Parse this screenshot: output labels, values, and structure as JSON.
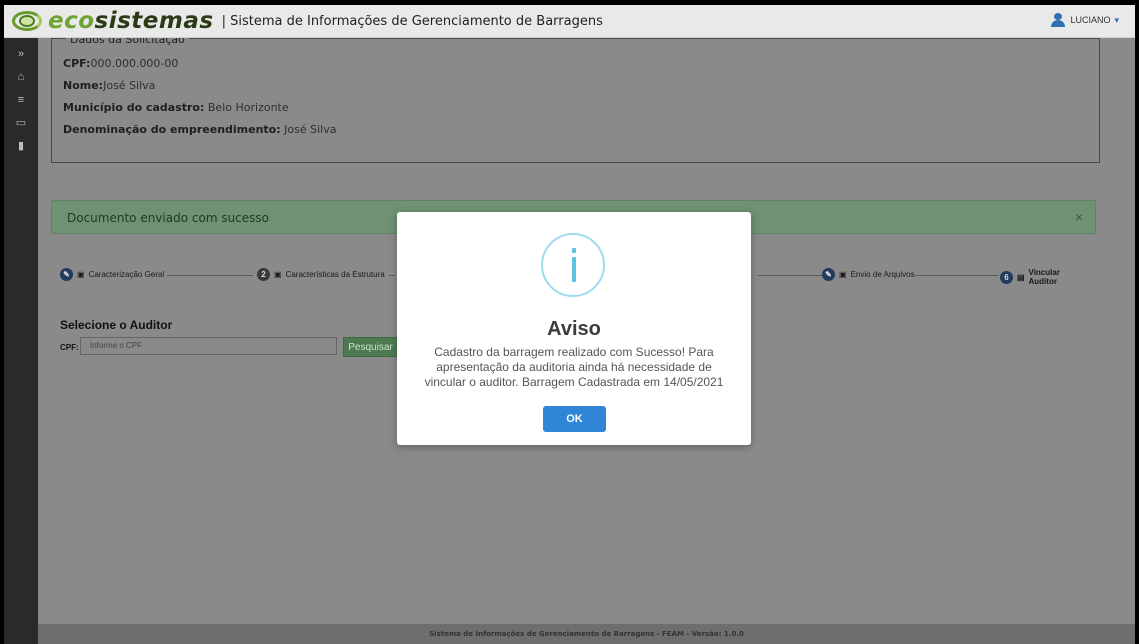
{
  "header": {
    "brand_eco": "eco",
    "brand_sistemas": "sistemas",
    "app_title": "| Sistema de Informações de Gerenciamento de Barragens",
    "user_name": "LUCIANO",
    "user_caret": "▾"
  },
  "sidebar": {
    "items": [
      {
        "icon": "double-chevron-icon",
        "glyph": "»"
      },
      {
        "icon": "home-icon",
        "glyph": "⌂"
      },
      {
        "icon": "menu-icon",
        "glyph": "≡"
      },
      {
        "icon": "id-card-icon",
        "glyph": "▭"
      },
      {
        "icon": "documents-icon",
        "glyph": "▮"
      }
    ]
  },
  "dados": {
    "legend": "Dados da Solicitação",
    "cpf_label": "CPF:",
    "cpf_value": "000.000.000-00",
    "nome_label": "Nome:",
    "nome_value": "José Silva",
    "municipio_label": "Município do cadastro:",
    "municipio_value": "Belo Horizonte",
    "denominacao_label": "Denominação do empreendimento:",
    "denominacao_value": "José Silva"
  },
  "alert": {
    "text": "Documento enviado com sucesso",
    "close": "×"
  },
  "steps": [
    {
      "label": "Caracterização Geral",
      "marker": "✎"
    },
    {
      "label": "Características da Estrutura",
      "marker": "2"
    },
    {
      "label": "Envio de Arquivos",
      "marker": "✎"
    },
    {
      "label": "Vincular Auditor",
      "marker": "6"
    }
  ],
  "auditor": {
    "title": "Selecione o Auditor",
    "cpf_label": "CPF:",
    "cpf_placeholder": "Informe o CPF",
    "search_label": "Pesquisar"
  },
  "footer": {
    "text": "Sistema de Informações de Gerenciamento de Barragens - FEAM - Versão: 1.0.0"
  },
  "modal": {
    "title": "Aviso",
    "message": "Cadastro da barragem realizado com Sucesso! Para apresentação da auditoria ainda há necessidade de vincular o auditor. Barragem Cadastrada em 14/05/2021",
    "ok_label": "OK"
  },
  "colors": {
    "brand_green": "#6fa334",
    "ok_blue": "#3085d6",
    "info_ring": "#9edbf0"
  }
}
